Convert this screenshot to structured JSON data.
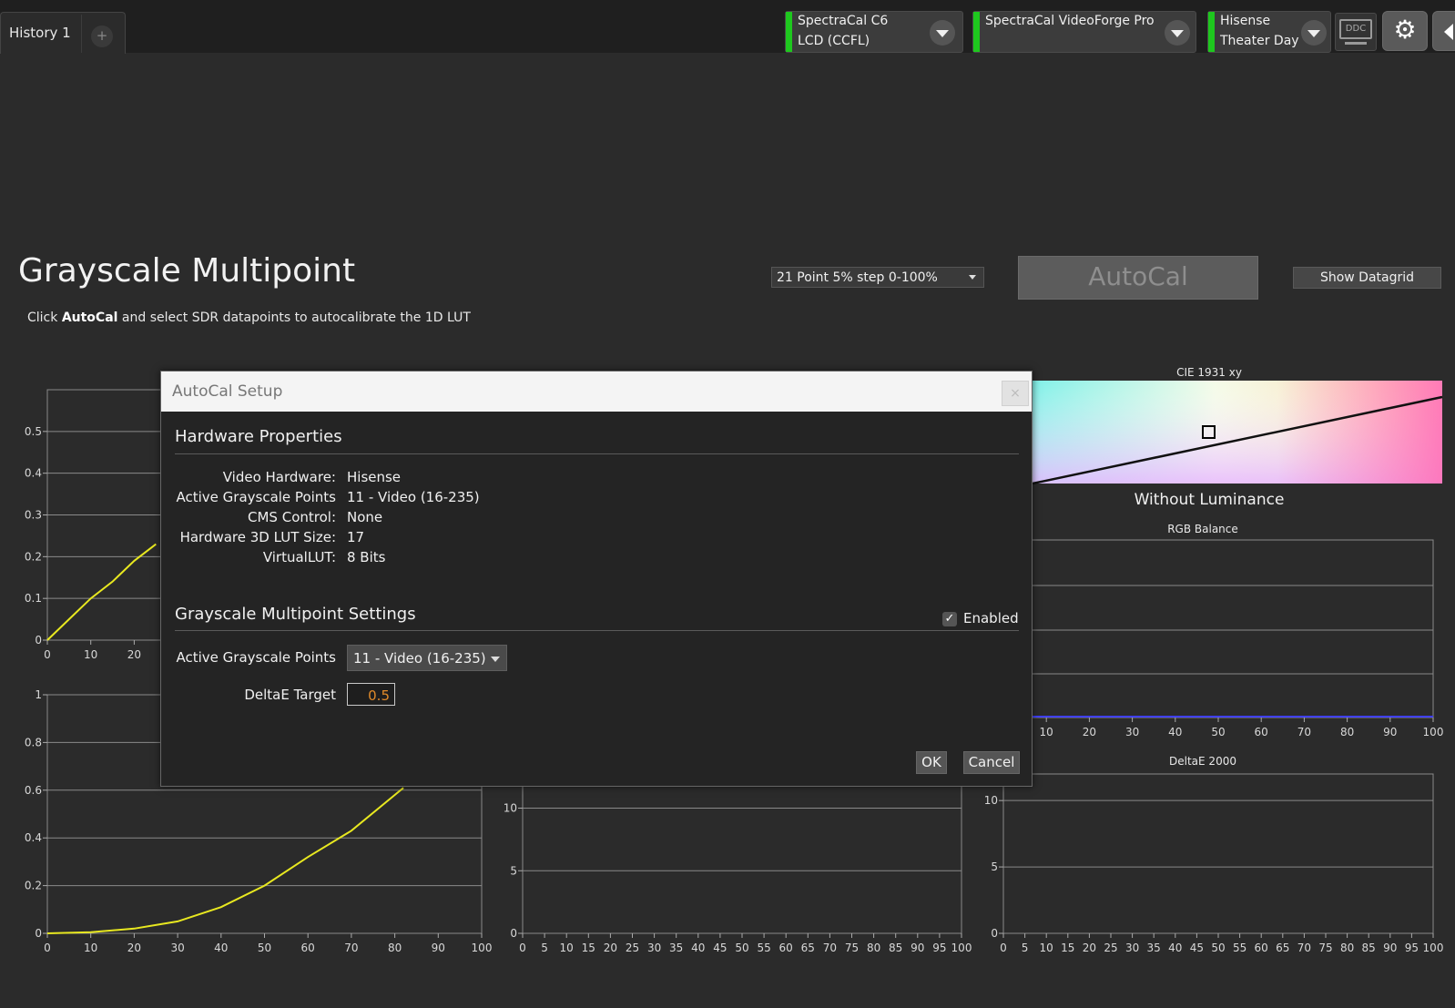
{
  "tabs": [
    {
      "label": "History 1"
    }
  ],
  "tab_add_label": "+",
  "devices": [
    {
      "line1": "SpectraCal C6",
      "line2": "LCD (CCFL)",
      "status_color": "#1ec81e"
    },
    {
      "line1": "SpectraCal VideoForge Pro",
      "line2": "",
      "status_color": "#1ec81e"
    },
    {
      "line1": "Hisense",
      "line2": "Theater Day",
      "status_color": "#1ec81e"
    }
  ],
  "ddc_label": "DDC",
  "gear_glyph": "⚙",
  "page": {
    "title": "Grayscale Multipoint",
    "subtitle_pre": "Click ",
    "subtitle_bold": "AutoCal",
    "subtitle_post": " and select SDR datapoints to autocalibrate the 1D LUT"
  },
  "preset_select": {
    "value": "21 Point 5% step 0-100%"
  },
  "autocal_button": "AutoCal",
  "show_datagrid_button": "Show Datagrid",
  "chart_data": [
    {
      "type": "line",
      "x_ticks": [
        "0",
        "10",
        "20"
      ],
      "y_ticks": [
        "0",
        "0.1",
        "0.2",
        "0.3",
        "0.4",
        "0.5"
      ],
      "series": [
        {
          "values_x": [
            0,
            5,
            10,
            15,
            20,
            25
          ],
          "values_y": [
            0,
            0.05,
            0.1,
            0.14,
            0.19,
            0.23
          ]
        }
      ],
      "color": "#e8e820",
      "ylim": [
        0,
        0.6
      ]
    },
    {
      "type": "line",
      "x_ticks": [
        "0",
        "10",
        "20",
        "30",
        "40",
        "50",
        "60",
        "70",
        "80",
        "90",
        "100"
      ],
      "y_ticks": [
        "0",
        "0.2",
        "0.4",
        "0.6",
        "0.8",
        "1"
      ],
      "series": [
        {
          "values_x": [
            0,
            10,
            20,
            30,
            40,
            50,
            60,
            70,
            80,
            82
          ],
          "values_y": [
            0,
            0.005,
            0.02,
            0.05,
            0.11,
            0.2,
            0.32,
            0.43,
            0.58,
            0.61
          ]
        }
      ],
      "color": "#e8e820",
      "ylim": [
        0,
        1
      ]
    },
    {
      "type": "line",
      "x_ticks": [
        "0",
        "5",
        "10",
        "15",
        "20",
        "25",
        "30",
        "35",
        "40",
        "45",
        "50",
        "55",
        "60",
        "65",
        "70",
        "75",
        "80",
        "85",
        "90",
        "95",
        "100"
      ],
      "y_ticks": [
        "0",
        "5",
        "10"
      ],
      "series": [],
      "ylim": [
        0,
        12
      ]
    },
    {
      "type": "scatter",
      "title": "CIE 1931 xy",
      "subtitle": "Without Luminance"
    },
    {
      "type": "line",
      "title": "RGB Balance",
      "x_ticks": [
        "10",
        "20",
        "30",
        "40",
        "50",
        "60",
        "70",
        "80",
        "90",
        "100"
      ],
      "series": [
        {
          "values_x": [
            0,
            100
          ],
          "values_y": [
            0,
            0
          ]
        }
      ],
      "color": "#4040ff"
    },
    {
      "type": "bar",
      "title": "DeltaE 2000",
      "x_ticks": [
        "0",
        "5",
        "10",
        "15",
        "20",
        "25",
        "30",
        "35",
        "40",
        "45",
        "50",
        "55",
        "60",
        "65",
        "70",
        "75",
        "80",
        "85",
        "90",
        "95",
        "100"
      ],
      "y_ticks": [
        "0",
        "5",
        "10"
      ],
      "series": [],
      "ylim": [
        0,
        12
      ]
    }
  ],
  "modal": {
    "title": "AutoCal Setup",
    "close_glyph": "×",
    "hardware_title": "Hardware Properties",
    "properties": [
      {
        "label": "Video Hardware:",
        "value": "Hisense"
      },
      {
        "label": "Active Grayscale Points",
        "value": "11 - Video (16-235)"
      },
      {
        "label": "CMS Control:",
        "value": "None"
      },
      {
        "label": "Hardware 3D LUT Size:",
        "value": "17"
      },
      {
        "label": "VirtualLUT:",
        "value": "8 Bits"
      }
    ],
    "settings_title": "Grayscale Multipoint Settings",
    "enabled_label": "Enabled",
    "enabled_checked": true,
    "check_glyph": "✓",
    "active_points_label": "Active Grayscale Points",
    "active_points_value": "11 - Video (16-235)",
    "delta_label": "DeltaE Target",
    "delta_value": "0.5",
    "ok_label": "OK",
    "cancel_label": "Cancel"
  },
  "colors": {
    "accent_orange": "#e08a2a",
    "curve_yellow": "#e8e820",
    "status_green": "#1ec81e",
    "rgb_blue": "#4040ff"
  }
}
